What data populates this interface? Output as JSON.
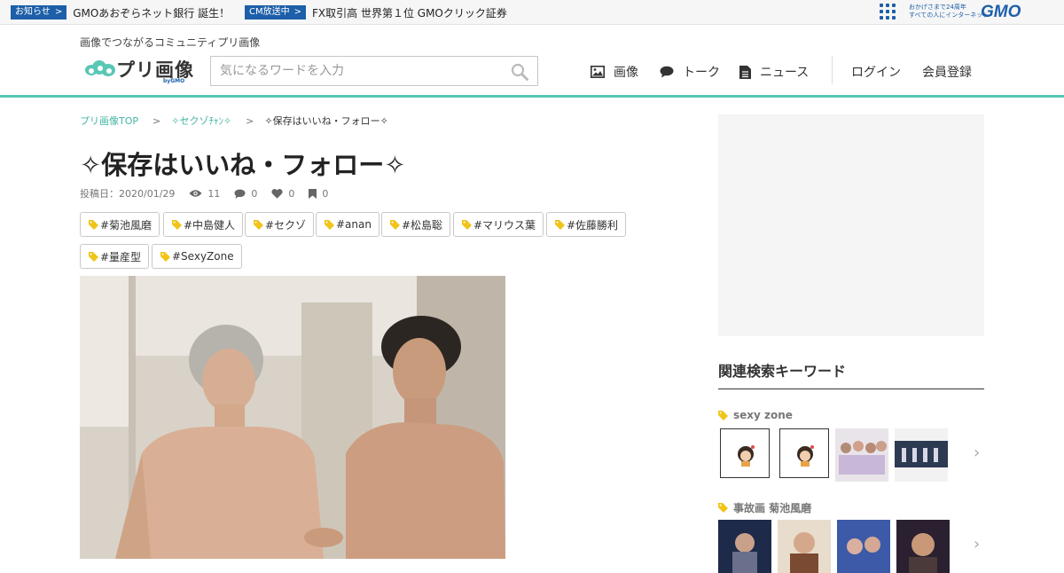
{
  "topbar": {
    "ticker1": {
      "badge": "お知らせ",
      "text": "GMOあおぞらネット銀行 誕生！"
    },
    "ticker2": {
      "badge": "CM放送中",
      "text": "FX取引高 世界第１位 GMOクリック証券"
    },
    "gmo_tagline_1": "おかげさまで24周年",
    "gmo_tagline_2": "すべての人にインターネット",
    "gmo_logo": "GMO",
    "chevron": ">"
  },
  "header": {
    "tagline": "画像でつながるコミュニティプリ画像",
    "logo_text": "プリ画像",
    "logo_by": "byGMO",
    "search_placeholder": "気になるワードを入力",
    "nav": {
      "images": "画像",
      "talk": "トーク",
      "news": "ニュース",
      "login": "ログイン",
      "register": "会員登録"
    }
  },
  "breadcrumb": {
    "home": "プリ画像TOP",
    "category": "✧セクゾﾁｬﾝ✧",
    "current": "✧保存はいいね・フォロー✧",
    "separator": ">"
  },
  "post": {
    "title": "✧保存はいいね・フォロー✧",
    "posted_label": "投稿日：2020/01/29",
    "views": "11",
    "comments": "0",
    "likes": "0",
    "saves": "0",
    "tags": [
      "#菊池風磨",
      "#中島健人",
      "#セクゾ",
      "#anan",
      "#松島聡",
      "#マリウス葉",
      "#佐藤勝利",
      "#量産型",
      "#SexyZone"
    ]
  },
  "sidebar": {
    "title": "関連検索キーワード",
    "keywords": [
      {
        "label": "sexy zone"
      },
      {
        "label": "事故画 菊池風磨"
      }
    ],
    "more_arrow": "›"
  },
  "colors": {
    "accent": "#5ac6b6",
    "link": "#45b5a5",
    "gmo_blue": "#1d5fa8",
    "tag_icon": "#f0c419"
  }
}
